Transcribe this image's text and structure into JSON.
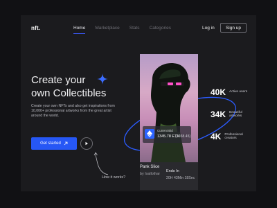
{
  "nav": {
    "logo": "nft.",
    "links": [
      "Home",
      "Marketplace",
      "Stats",
      "Categories"
    ],
    "active": "Home",
    "login": "Log in",
    "signup": "Sign up"
  },
  "hero": {
    "title_line1": "Create your",
    "title_line2": "own Collectibles",
    "description": "Create your own NFTs and also get inspirations from 10,000+ professional artworks from the great artist around the world.",
    "cta_label": "Get started",
    "how_it_works": "How it works?"
  },
  "card": {
    "current_bid_label": "Current Bid",
    "bid_eth": "1345.78 ETH",
    "bid_usd": "(2038.45)",
    "name": "Pank Slice",
    "author": "by Ixallothar",
    "ends_label": "Ends In",
    "ends_time": "20H 43Min 18Sec"
  },
  "stats": [
    {
      "value": "40K",
      "label": "Active users"
    },
    {
      "value": "34K",
      "label": "Beautiful artworks"
    },
    {
      "value": "4K",
      "label": "Professional creators"
    }
  ],
  "colors": {
    "accent": "#2657f5",
    "background": "#1b1b1e",
    "outer": "#111114"
  },
  "icons": [
    "sparkle-icon",
    "arrow-up-right-icon",
    "play-icon",
    "ethereum-icon",
    "sketch-arrow-icon"
  ]
}
